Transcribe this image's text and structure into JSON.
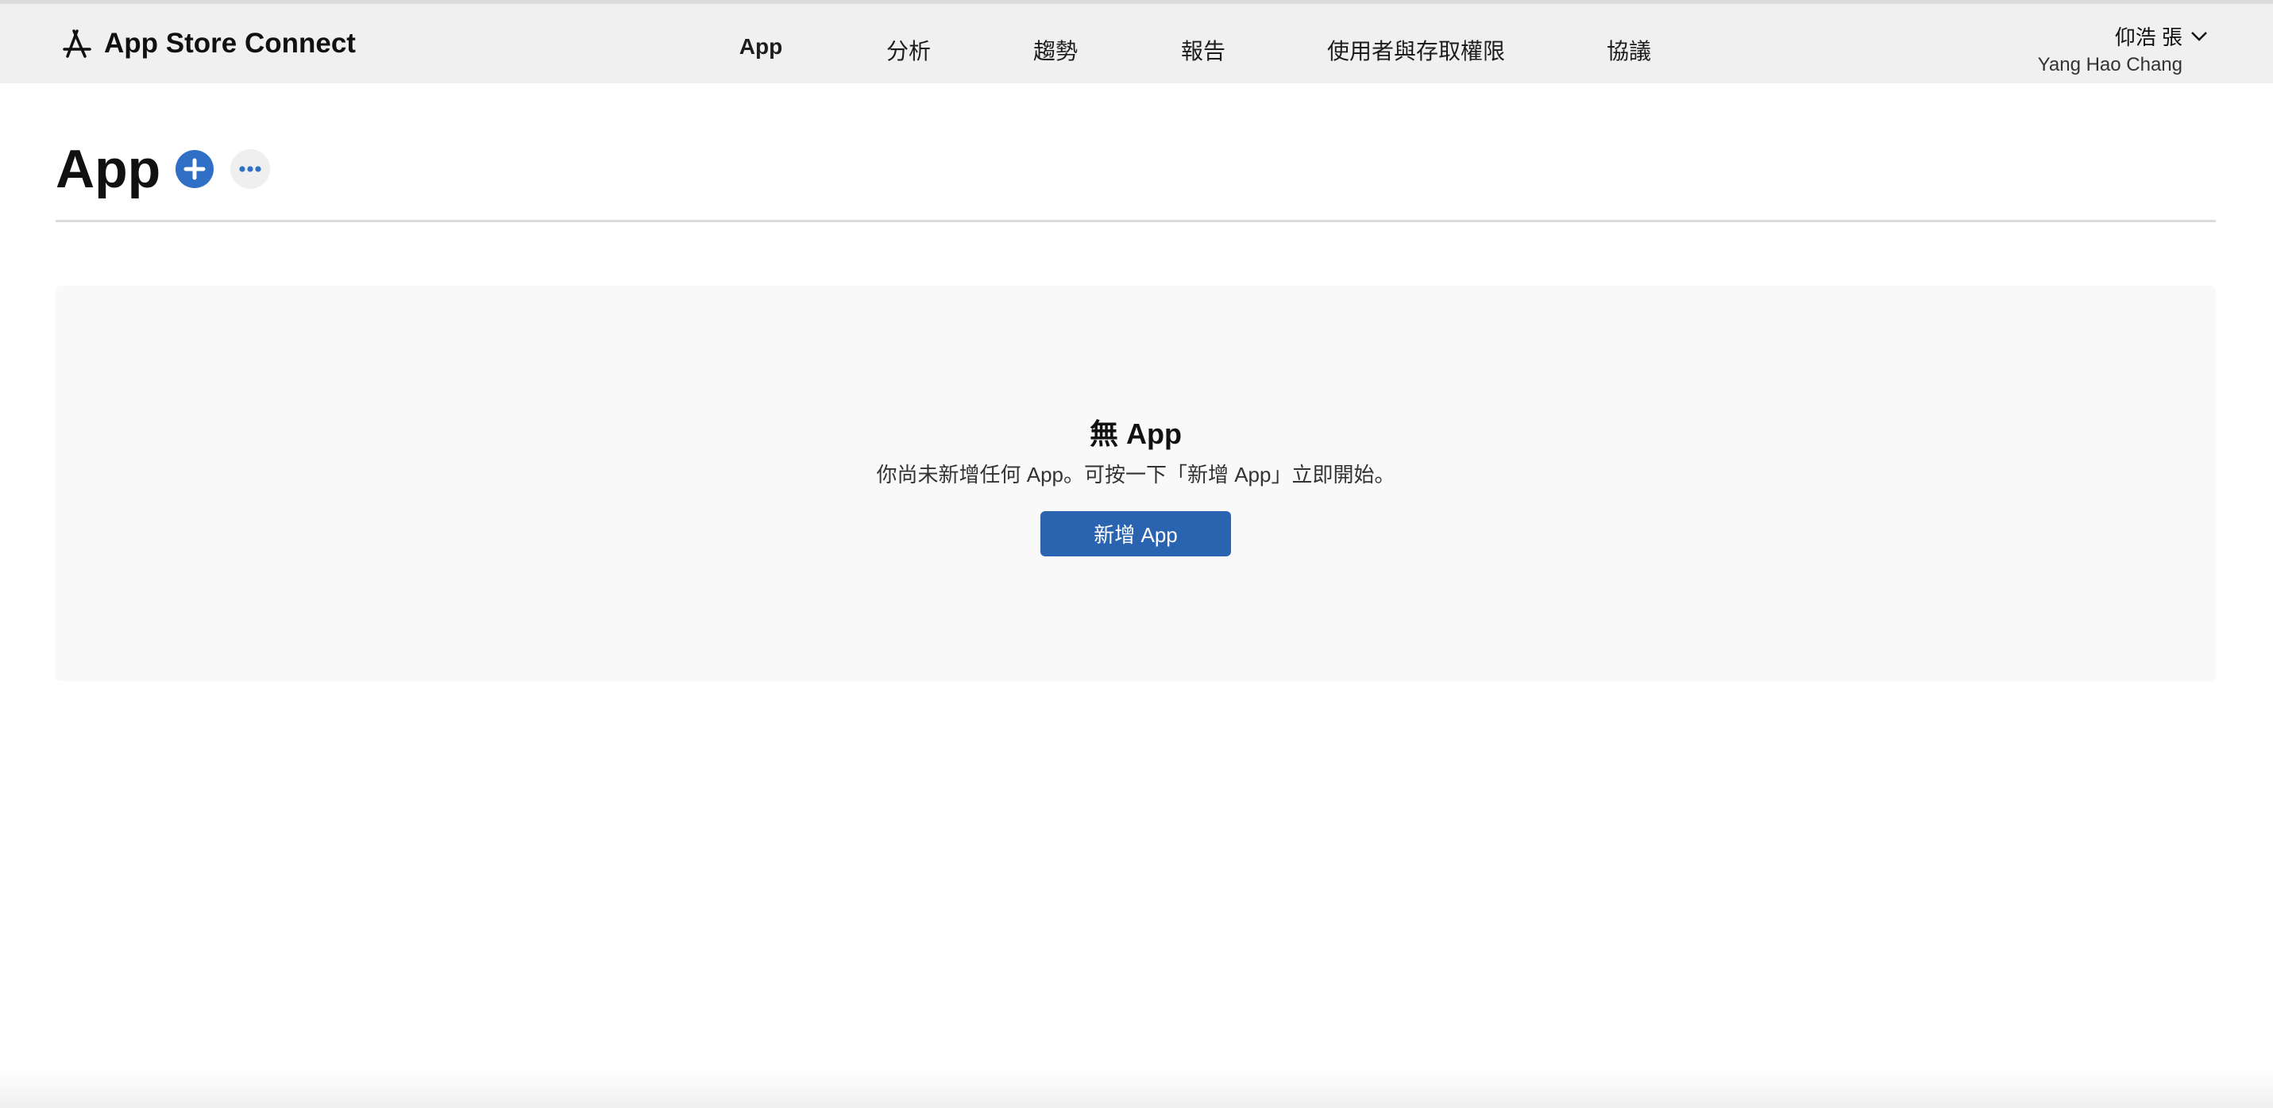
{
  "header": {
    "app_title": "App Store Connect",
    "logo_icon": "app-store-icon",
    "nav": [
      {
        "label": "App",
        "active": true
      },
      {
        "label": "分析",
        "active": false
      },
      {
        "label": "趨勢",
        "active": false
      },
      {
        "label": "報告",
        "active": false
      },
      {
        "label": "使用者與存取權限",
        "active": false
      },
      {
        "label": "協議",
        "active": false
      }
    ],
    "user": {
      "name": "仰浩 張",
      "subtitle": "Yang Hao Chang",
      "icon": "chevron-down-icon"
    }
  },
  "page": {
    "title": "App",
    "add_icon": "plus-circle-icon",
    "more_icon": "ellipsis-icon"
  },
  "empty_state": {
    "title": "無 App",
    "message": "你尚未新增任何 App。可按一下「新增 App」立即開始。",
    "button_label": "新增 App"
  },
  "colors": {
    "accent": "#2a64b0",
    "header_bg": "#f0f0f0",
    "panel_bg": "#f9f9f9"
  }
}
